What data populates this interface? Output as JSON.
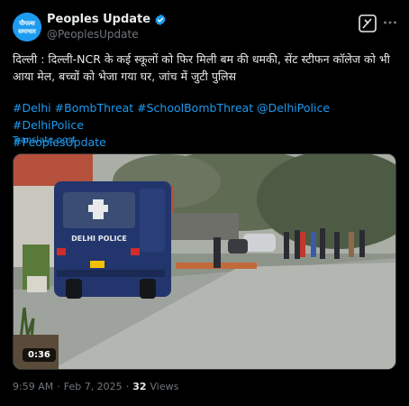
{
  "post": {
    "author_name": "Peoples Update",
    "author_handle": "@PeoplesUpdate",
    "avatar_text_line1": "पीपल्स",
    "avatar_text_line2": "समाचार",
    "body": "दिल्ली : दिल्ली-NCR के कई स्कूलों को फिर मिली बम की धमकी, सेंट स्टीफन कॉलेज को भी आया मेल, बच्चों को भेजा गया घर, जांच में जुटी पुलिस",
    "hashtags": [
      "#Delhi",
      "#BombThreat",
      "#SchoolBombThreat",
      "@DelhiPolice",
      "#DelhiPolice",
      "#PeoplesUpdate"
    ],
    "translate_label": "Translate post",
    "video_duration": "0:36",
    "bus_label": "DELHI POLICE",
    "time": "9:59 AM",
    "date": "Feb 7, 2025",
    "views_count": "32",
    "views_label": "Views"
  },
  "icons": {
    "verified": "verified-badge-icon",
    "grok": "grok-icon",
    "more": "more-options-icon"
  },
  "colors": {
    "background": "#000000",
    "accent": "#1d9bf0",
    "text": "#e7e9ea",
    "muted": "#71767b"
  }
}
